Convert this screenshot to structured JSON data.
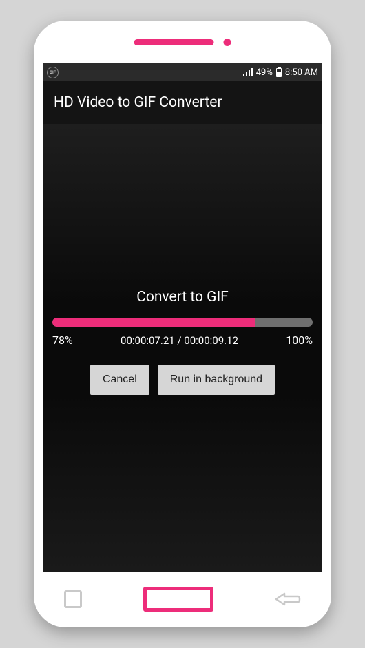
{
  "status": {
    "battery_text": "49%",
    "time": "8:50 AM"
  },
  "header": {
    "title": "HD Video to GIF Converter"
  },
  "convert": {
    "title": "Convert to GIF",
    "percent_label": "78%",
    "percent_value": 78,
    "time_text": "00:00:07.21 / 00:00:09.12",
    "max_label": "100%"
  },
  "buttons": {
    "cancel": "Cancel",
    "background": "Run in background"
  },
  "colors": {
    "accent": "#ed2d7a"
  }
}
